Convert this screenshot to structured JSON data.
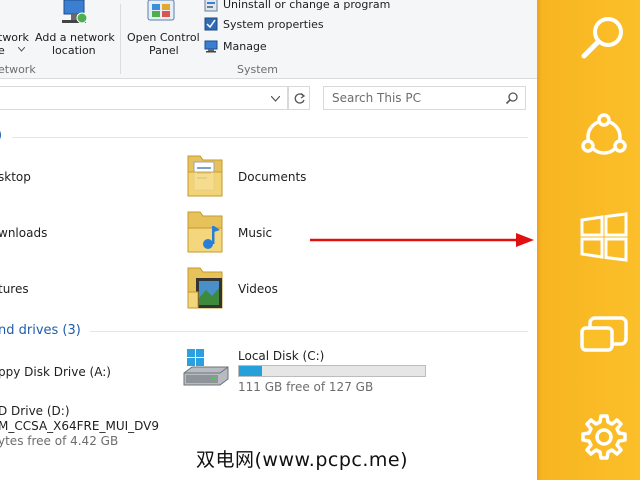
{
  "ribbon": {
    "network_btn_line1": "twork",
    "network_btn_line2": "e",
    "add_network_line1": "Add a network",
    "add_network_line2": "location",
    "network_group": "etwork",
    "open_cp_line1": "Open Control",
    "open_cp_line2": "Panel",
    "uninstall": "Uninstall or change a program",
    "system_properties": "System properties",
    "manage": "Manage",
    "system_group": "System"
  },
  "search": {
    "placeholder": "Search This PC"
  },
  "folders": {
    "section_suffix": ")",
    "desktop": "sktop",
    "downloads": "wnloads",
    "pictures": "tures",
    "documents": "Documents",
    "music": "Music",
    "videos": "Videos"
  },
  "drives": {
    "section_title": "nd drives (3)",
    "floppy": "ppy Disk Drive (A:)",
    "dvd_line1": "D Drive (D:)",
    "dvd_line2": "M_CCSA_X64FRE_MUI_DV9",
    "dvd_line3": "ytes free of 4.42 GB",
    "local_disk": "Local Disk (C:)",
    "local_disk_free": "111 GB free of 127 GB",
    "local_disk_used_fraction": 0.126
  },
  "charms": [
    "search-icon",
    "share-icon",
    "windows-start-icon",
    "devices-icon",
    "settings-icon"
  ],
  "watermark": "双电网(www.pcpc.me)",
  "colors": {
    "charm_bar": "#fbbf2a",
    "accent_arrow": "#e01010",
    "disk_bar": "#26a0da"
  }
}
